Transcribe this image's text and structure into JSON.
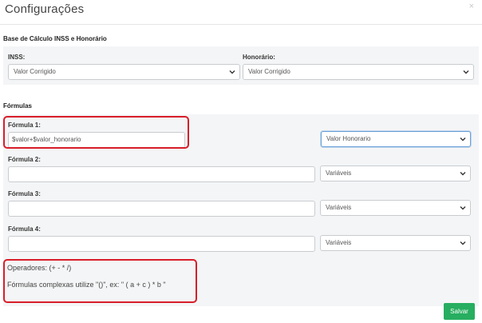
{
  "modal": {
    "title": "Configurações",
    "close_glyph": "×"
  },
  "base_calculo": {
    "heading": "Base de Cálculo INSS e Honorário",
    "inss_label": "INSS:",
    "inss_value": "Valor Corrigido",
    "honorario_label": "Honorário:",
    "honorario_value": "Valor Corrigido"
  },
  "formulas": {
    "heading": "Fórmulas",
    "items": [
      {
        "label": "Fórmula 1:",
        "value": "$valor+$valor_honorario",
        "select_value": "Valor Honorario"
      },
      {
        "label": "Fórmula 2:",
        "value": "",
        "select_value": "Variáveis"
      },
      {
        "label": "Fórmula 3:",
        "value": "",
        "select_value": "Variáveis"
      },
      {
        "label": "Fórmula 4:",
        "value": "",
        "select_value": "Variáveis"
      }
    ],
    "operators_text": "Operadores: (+ - * /)",
    "complex_text": "Fórmulas complexas utilize \"()\", ex: \" ( a + c ) * b \""
  },
  "footer": {
    "save_label": "Salvar"
  },
  "colors": {
    "highlight": "#d81e2a",
    "save_button": "#27ae60"
  },
  "icons": {
    "close": "close-icon",
    "dropdown": "chevron-down-icon"
  }
}
